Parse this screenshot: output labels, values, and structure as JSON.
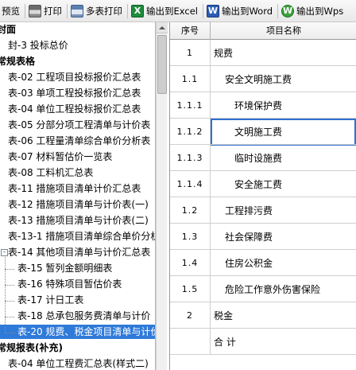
{
  "toolbar": {
    "buttons": [
      {
        "label": "预览",
        "icon": "preview-icon"
      },
      {
        "label": "打印",
        "icon": "print-icon"
      },
      {
        "label": "多表打印",
        "icon": "multi-print-icon"
      },
      {
        "label": "输出到Excel",
        "icon": "excel-icon",
        "glyph": "X"
      },
      {
        "label": "输出到Word",
        "icon": "word-icon",
        "glyph": "W"
      },
      {
        "label": "输出到Wps",
        "icon": "wps-icon",
        "glyph": "W"
      }
    ]
  },
  "tree": {
    "items": [
      {
        "label": "封面",
        "kind": "group",
        "indent": 0
      },
      {
        "label": "封-3  投标总价",
        "kind": "item",
        "indent": 1
      },
      {
        "label": "常规表格",
        "kind": "group",
        "indent": 0
      },
      {
        "label": "表-02  工程项目投标报价汇总表",
        "kind": "item",
        "indent": 1
      },
      {
        "label": "表-03  单项工程投标报价汇总表",
        "kind": "item",
        "indent": 1
      },
      {
        "label": "表-04  单位工程投标报价汇总表",
        "kind": "item",
        "indent": 1
      },
      {
        "label": "表-05  分部分项工程清单与计价表",
        "kind": "item",
        "indent": 1
      },
      {
        "label": "表-06  工程量清单综合单价分析表",
        "kind": "item",
        "indent": 1
      },
      {
        "label": "表-07  材料暂估价一览表",
        "kind": "item",
        "indent": 1
      },
      {
        "label": "表-08  工料机汇总表",
        "kind": "item",
        "indent": 1
      },
      {
        "label": "表-11  措施项目清单计价汇总表",
        "kind": "item",
        "indent": 1
      },
      {
        "label": "表-12  措施项目清单与计价表(一)",
        "kind": "item",
        "indent": 1
      },
      {
        "label": "表-13  措施项目清单与计价表(二)",
        "kind": "item",
        "indent": 1
      },
      {
        "label": "表-13-1  措施项目清单综合单价分析",
        "kind": "item",
        "indent": 1
      },
      {
        "label": "表-14  其他项目清单与计价汇总表",
        "kind": "parent",
        "indent": 1
      },
      {
        "label": "表-15  暂列金额明细表",
        "kind": "item",
        "indent": 2
      },
      {
        "label": "表-16  特殊项目暂估价表",
        "kind": "item",
        "indent": 2
      },
      {
        "label": "表-17  计日工表",
        "kind": "item",
        "indent": 2
      },
      {
        "label": "表-18  总承包服务费清单与计价",
        "kind": "item",
        "indent": 2
      },
      {
        "label": "表-20  规费、税金项目清单与计价",
        "kind": "item",
        "indent": 2,
        "selected": true
      },
      {
        "label": "常规报表(补充)",
        "kind": "group",
        "indent": 0
      },
      {
        "label": "表-04  单位工程费汇总表(样式二)",
        "kind": "item",
        "indent": 1
      }
    ]
  },
  "grid": {
    "headers": {
      "seq": "序号",
      "name": "项目名称"
    },
    "rows": [
      {
        "seq": "1",
        "name": "规费",
        "level": 0
      },
      {
        "seq": "1.1",
        "name": "安全文明施工费",
        "level": 1
      },
      {
        "seq": "1.1.1",
        "name": "环境保护费",
        "level": 2
      },
      {
        "seq": "1.1.2",
        "name": "文明施工费",
        "level": 2,
        "focused": true
      },
      {
        "seq": "1.1.3",
        "name": "临时设施费",
        "level": 2
      },
      {
        "seq": "1.1.4",
        "name": "安全施工费",
        "level": 2
      },
      {
        "seq": "1.2",
        "name": "工程排污费",
        "level": 1
      },
      {
        "seq": "1.3",
        "name": "社会保障费",
        "level": 1
      },
      {
        "seq": "1.4",
        "name": "住房公积金",
        "level": 1
      },
      {
        "seq": "1.5",
        "name": "危险工作意外伤害保险",
        "level": 1
      },
      {
        "seq": "2",
        "name": "税金",
        "level": 0
      },
      {
        "seq": "",
        "name": "合 计",
        "level": 0
      }
    ]
  },
  "colors": {
    "selection": "#2f7ad9",
    "focus": "#2f6fd0"
  }
}
